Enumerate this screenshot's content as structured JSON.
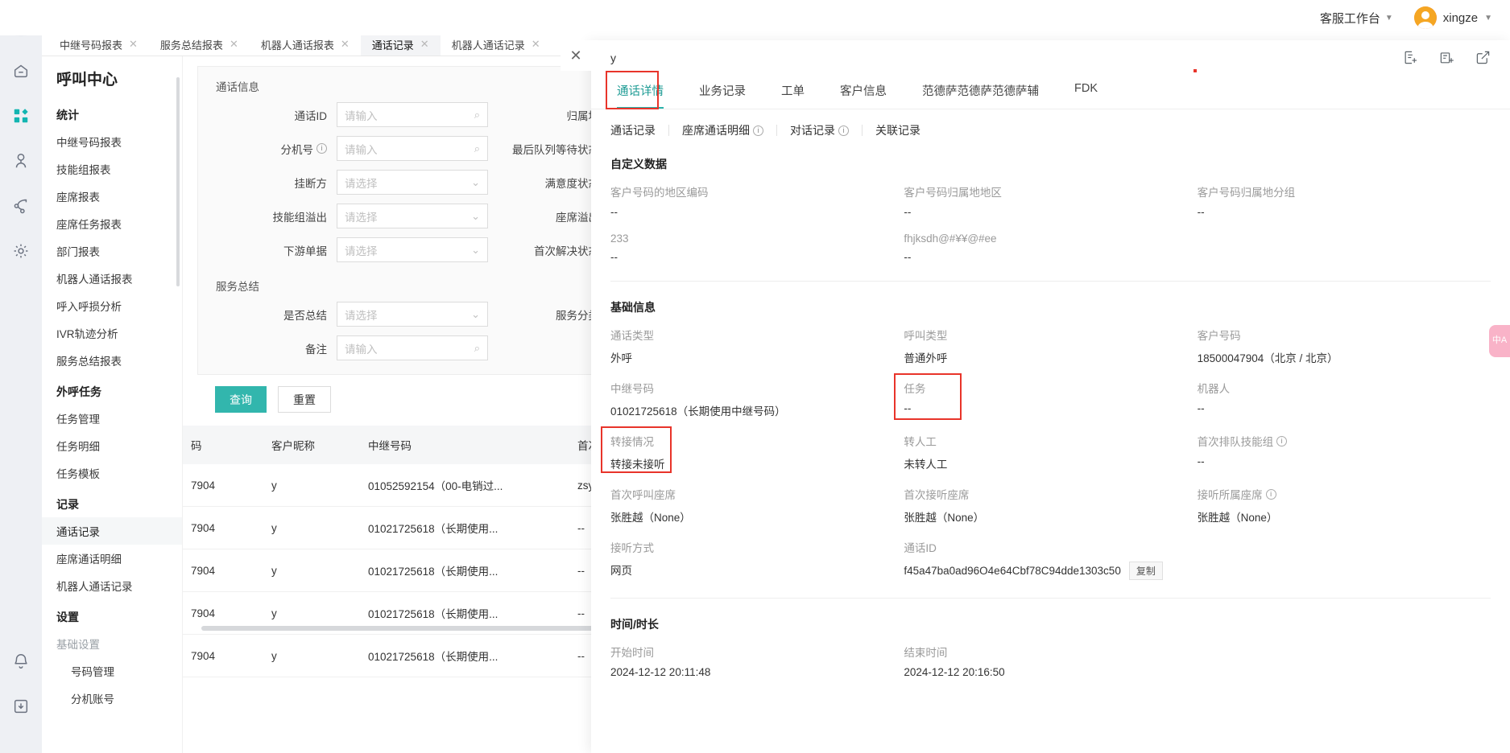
{
  "header": {
    "workbench_label": "客服工作台",
    "user_name": "xingze"
  },
  "rail": {
    "icons": [
      "home-icon",
      "apps-icon",
      "user-icon",
      "flow-icon",
      "gear-icon",
      "bell-icon",
      "download-icon"
    ]
  },
  "tabstrip": {
    "tabs": [
      {
        "label": "中继号码报表",
        "active": false
      },
      {
        "label": "服务总结报表",
        "active": false
      },
      {
        "label": "机器人通话报表",
        "active": false
      },
      {
        "label": "通话记录",
        "active": true
      },
      {
        "label": "机器人通话记录",
        "active": false
      }
    ]
  },
  "sidebar": {
    "title": "呼叫中心",
    "groups": [
      {
        "label": "统计",
        "items": [
          {
            "label": "中继号码报表"
          },
          {
            "label": "技能组报表"
          },
          {
            "label": "座席报表"
          },
          {
            "label": "座席任务报表"
          },
          {
            "label": "部门报表"
          },
          {
            "label": "机器人通话报表"
          },
          {
            "label": "呼入呼损分析"
          },
          {
            "label": "IVR轨迹分析"
          },
          {
            "label": "服务总结报表"
          }
        ]
      },
      {
        "label": "外呼任务",
        "items": [
          {
            "label": "任务管理"
          },
          {
            "label": "任务明细"
          },
          {
            "label": "任务模板"
          }
        ]
      },
      {
        "label": "记录",
        "items": [
          {
            "label": "通话记录",
            "active": true
          },
          {
            "label": "座席通话明细"
          },
          {
            "label": "机器人通话记录"
          }
        ]
      },
      {
        "label": "设置",
        "items": [
          {
            "label": "基础设置",
            "dim": true
          },
          {
            "label": "号码管理",
            "sub": true
          },
          {
            "label": "分机账号",
            "sub": true
          }
        ]
      }
    ]
  },
  "filters": {
    "section1_title": "通话信息",
    "section2_title": "服务总结",
    "placeholder_input": "请输入",
    "placeholder_select": "请选择",
    "rows": [
      {
        "left_label": "通话ID",
        "left_type": "input",
        "left_info": false,
        "right_label": "归属地",
        "right_type": "select"
      },
      {
        "left_label": "分机号",
        "left_type": "input",
        "left_info": true,
        "right_label": "最后队列等待状态",
        "right_type": "select"
      },
      {
        "left_label": "挂断方",
        "left_type": "select",
        "left_info": false,
        "right_label": "满意度状态",
        "right_type": "select"
      },
      {
        "left_label": "技能组溢出",
        "left_type": "select",
        "left_info": false,
        "right_label": "座席溢出",
        "right_type": "select"
      },
      {
        "left_label": "下游单据",
        "left_type": "select",
        "left_info": false,
        "right_label": "首次解决状态",
        "right_type": "select"
      }
    ],
    "rows2": [
      {
        "left_label": "是否总结",
        "left_type": "select",
        "left_info": false,
        "right_label": "服务分类",
        "right_type": "select"
      },
      {
        "left_label": "备注",
        "left_type": "input",
        "left_info": false,
        "right_label": "",
        "right_type": "none"
      }
    ],
    "search_button": "查询",
    "reset_button": "重置"
  },
  "table": {
    "columns": [
      "码",
      "客户昵称",
      "中继号码",
      "首次排队技能组"
    ],
    "rows": [
      [
        "7904",
        "y",
        "01052592154（00-电销过...",
        "zsy"
      ],
      [
        "7904",
        "y",
        "01021725618（长期使用...",
        "--"
      ],
      [
        "7904",
        "y",
        "01021725618（长期使用...",
        "--"
      ],
      [
        "7904",
        "y",
        "01021725618（长期使用...",
        "--"
      ],
      [
        "7904",
        "y",
        "01021725618（长期使用...",
        "--"
      ]
    ]
  },
  "drawer": {
    "title": "y",
    "close_label": "✕",
    "actions": [
      "note-add-icon",
      "ticket-add-icon",
      "external-link-icon"
    ],
    "tabs": [
      {
        "label": "通话详情",
        "active": true,
        "highlighted": true
      },
      {
        "label": "业务记录",
        "active": false
      },
      {
        "label": "工单",
        "active": false
      },
      {
        "label": "客户信息",
        "active": false
      },
      {
        "label": "范德萨范德萨范德萨辅",
        "active": false
      },
      {
        "label": "FDK",
        "active": false
      }
    ],
    "subtabs": [
      {
        "label": "通话记录",
        "info": false
      },
      {
        "label": "座席通话明细",
        "info": true
      },
      {
        "label": "对话记录",
        "info": true
      },
      {
        "label": "关联记录",
        "info": false
      }
    ],
    "custom_section": {
      "title": "自定义数据",
      "fields": [
        {
          "label": "客户号码的地区编码",
          "value": "--"
        },
        {
          "label": "客户号码归属地地区",
          "value": "--"
        },
        {
          "label": "客户号码归属地分组",
          "value": "--"
        },
        {
          "label": "233",
          "value": "--"
        },
        {
          "label": "fhjksdh@#¥¥@#ee",
          "value": "--"
        },
        {
          "label": "",
          "value": ""
        }
      ]
    },
    "basic_section": {
      "title": "基础信息",
      "fields": [
        {
          "label": "通话类型",
          "value": "外呼",
          "info": false,
          "highlighted": false
        },
        {
          "label": "呼叫类型",
          "value": "普通外呼",
          "info": false,
          "highlighted": false
        },
        {
          "label": "客户号码",
          "value": "18500047904（北京 / 北京）",
          "info": false,
          "highlighted": false
        },
        {
          "label": "中继号码",
          "value": "01021725618（长期使用中继号码）",
          "info": false,
          "highlighted": false
        },
        {
          "label": "任务",
          "value": "--",
          "info": false,
          "highlighted": true
        },
        {
          "label": "机器人",
          "value": "--",
          "info": false,
          "highlighted": false
        },
        {
          "label": "转接情况",
          "value": "转接未接听",
          "info": false,
          "highlighted": true
        },
        {
          "label": "转人工",
          "value": "未转人工",
          "info": false,
          "highlighted": false
        },
        {
          "label": "首次排队技能组",
          "value": "--",
          "info": true,
          "highlighted": false
        },
        {
          "label": "首次呼叫座席",
          "value": "张胜越（None）",
          "info": false,
          "highlighted": false
        },
        {
          "label": "首次接听座席",
          "value": "张胜越（None）",
          "info": false,
          "highlighted": false
        },
        {
          "label": "接听所属座席",
          "value": "张胜越（None）",
          "info": true,
          "highlighted": false
        },
        {
          "label": "接听方式",
          "value": "网页",
          "info": false,
          "highlighted": false
        },
        {
          "label": "通话ID",
          "value": "f45a47ba0ad96O4e64Cbf78C94dde1303c50",
          "info": false,
          "highlighted": false,
          "copy": "复制"
        },
        {
          "label": "",
          "value": "",
          "info": false,
          "highlighted": false
        }
      ]
    },
    "time_section": {
      "title": "时间/时长",
      "fields": [
        {
          "label": "开始时间",
          "value": "2024-12-12 20:11:48"
        },
        {
          "label": "结束时间",
          "value": "2024-12-12 20:16:50"
        },
        {
          "label": "",
          "value": ""
        }
      ]
    }
  },
  "lang_pill": "中A"
}
